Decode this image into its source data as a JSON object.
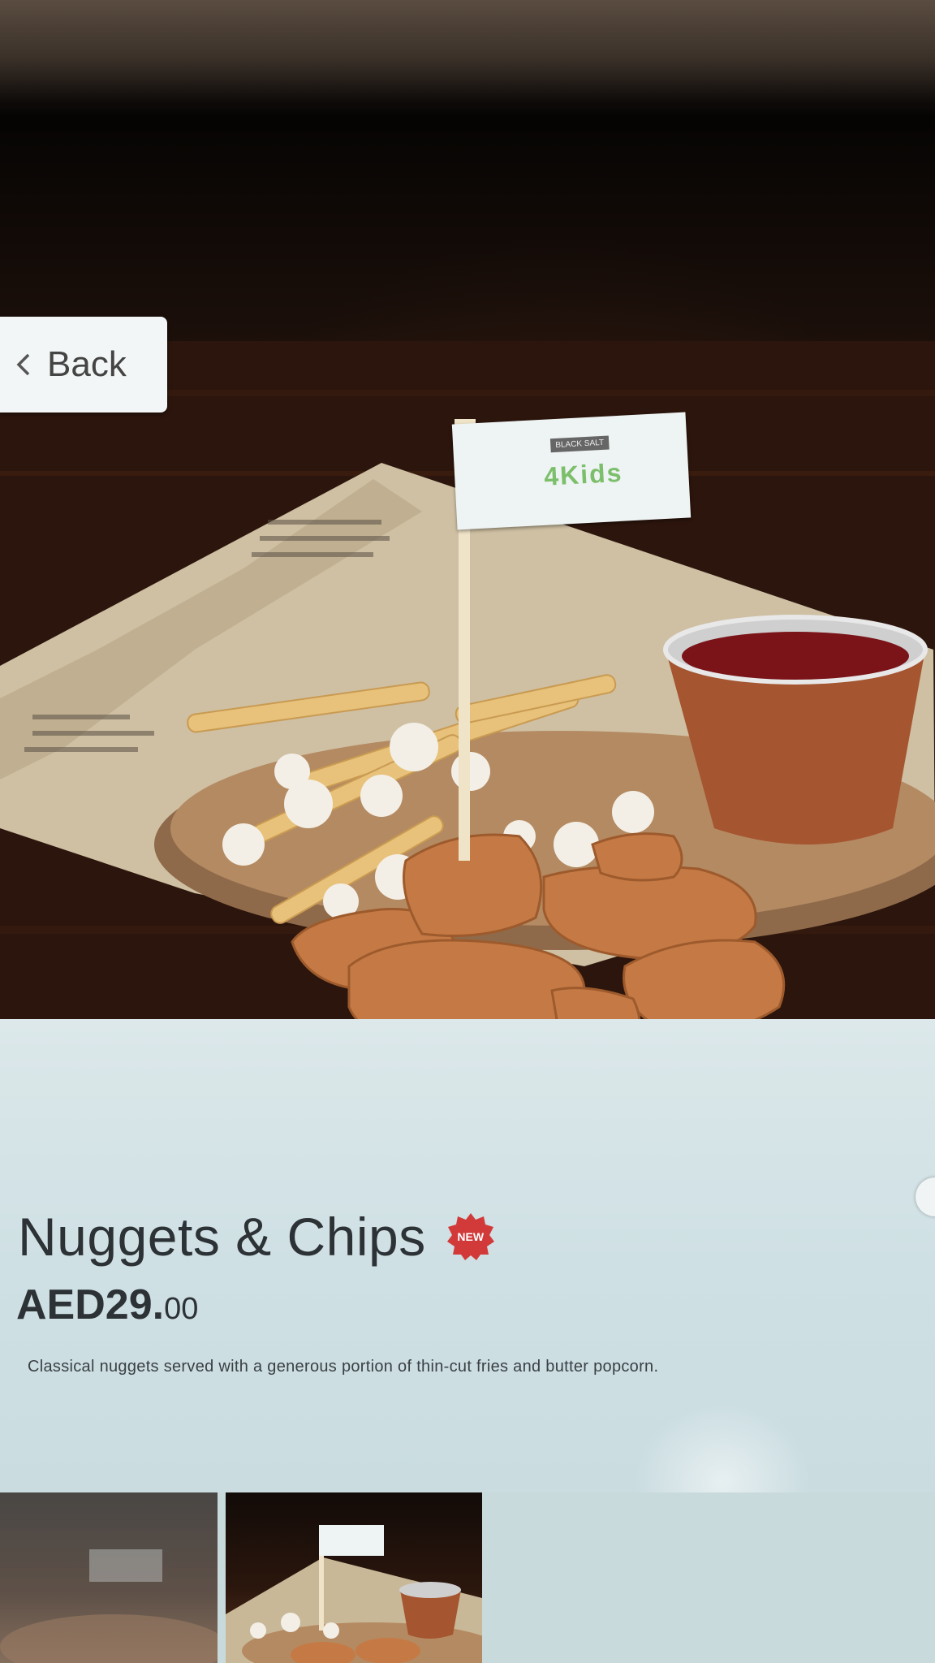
{
  "navigation": {
    "back_label": "Back"
  },
  "item": {
    "name": "Nuggets & Chips",
    "badge": "NEW",
    "price_main": "AED29.",
    "price_cents": "00",
    "description": "Classical nuggets served with a generous portion of thin-cut fries and butter popcorn."
  },
  "photo_flag": {
    "brand_small": "BLACK SALT",
    "brand_large": "4Kids"
  },
  "colors": {
    "badge_red": "#d23a3a",
    "text_dark": "#2c3236",
    "panel_bg": "#d6e5e8"
  },
  "thumbnails": [
    {
      "name": "thumbnail-1"
    },
    {
      "name": "thumbnail-2"
    }
  ]
}
